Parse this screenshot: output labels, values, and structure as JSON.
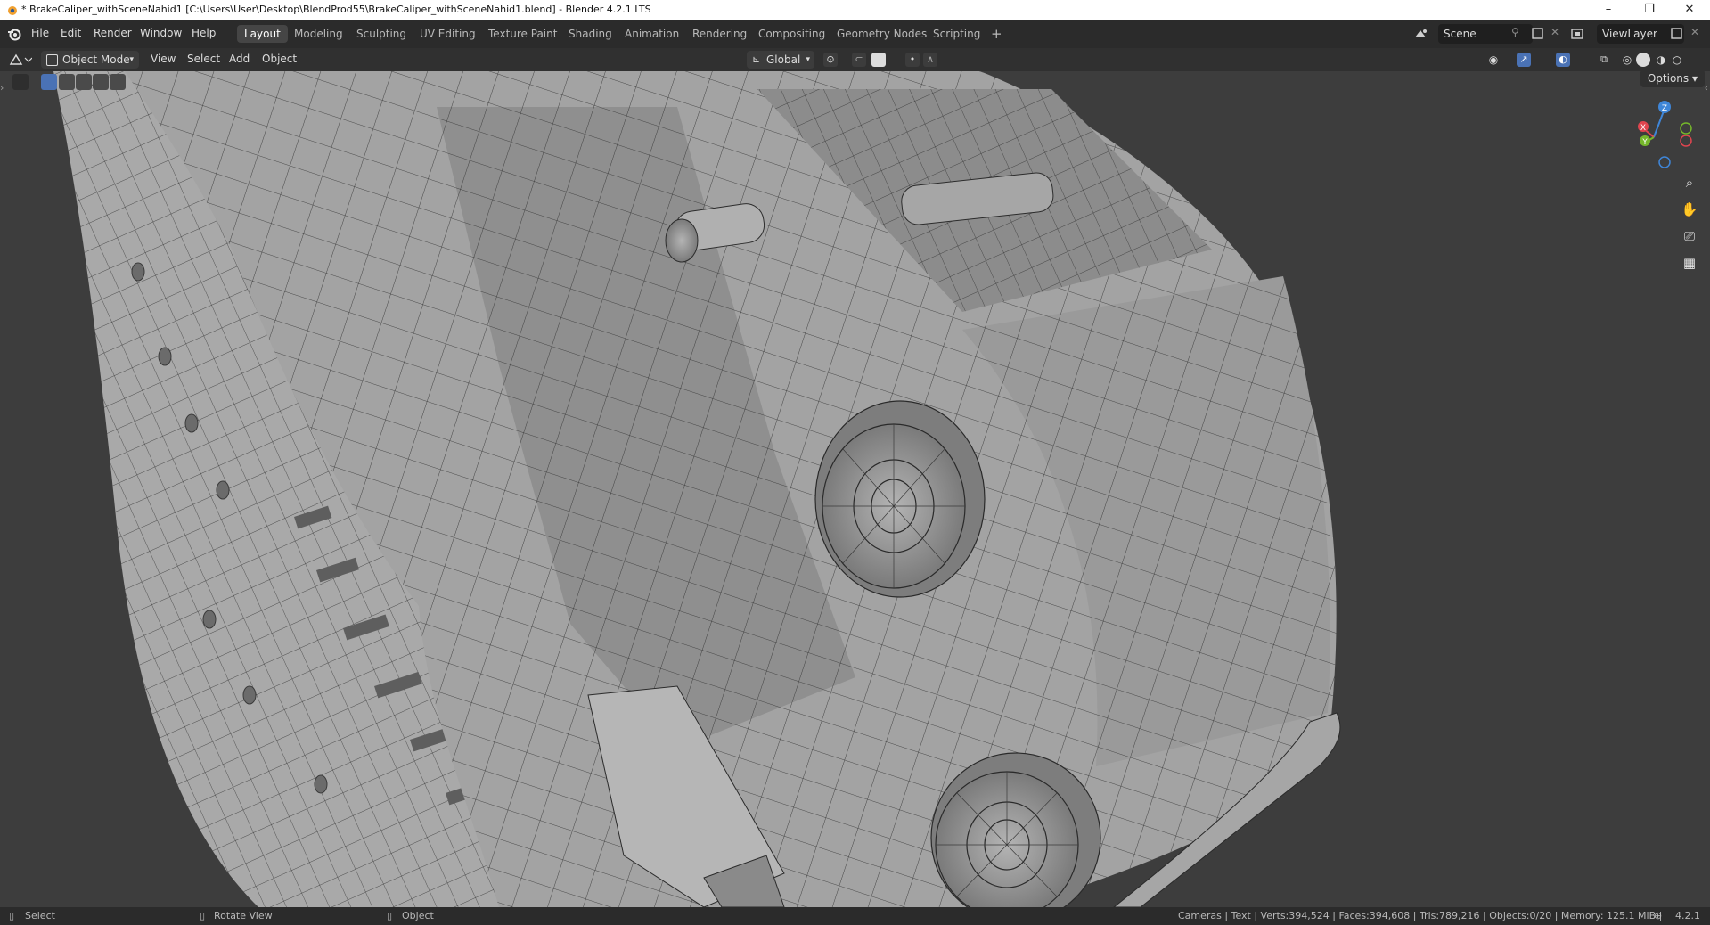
{
  "window": {
    "title": "* BrakeCaliper_withSceneNahid1 [C:\\Users\\User\\Desktop\\BlendProd55\\BrakeCaliper_withSceneNahid1.blend] - Blender 4.2.1 LTS",
    "controls": [
      "–",
      "❐",
      "✕"
    ]
  },
  "menu": [
    "File",
    "Edit",
    "Render",
    "Window",
    "Help"
  ],
  "workspaces": {
    "tabs": [
      "Layout",
      "Modeling",
      "Sculpting",
      "UV Editing",
      "Texture Paint",
      "Shading",
      "Animation",
      "Rendering",
      "Compositing",
      "Geometry Nodes",
      "Scripting"
    ],
    "active": "Layout",
    "add_label": "+"
  },
  "scene": {
    "name": "Scene",
    "view_layer": "ViewLayer"
  },
  "header": {
    "mode": "Object Mode",
    "menus": [
      "View",
      "Select",
      "Add",
      "Object"
    ],
    "orientation": "Global"
  },
  "viewport": {
    "options_label": "Options",
    "gizmo_axes": [
      "X",
      "Y",
      "Z"
    ],
    "shading_active": "solid"
  },
  "statusbar": {
    "left": [
      "Select",
      "Rotate View",
      "Object"
    ],
    "stats": "Cameras | Text | Verts:394,524 | Faces:394,608 | Tris:789,216 | Objects:0/20 | Memory: 125.1 MiB | ",
    "version": "4.2.1"
  },
  "colors": {
    "accent_active_tab": "#454545",
    "active_tool": "#4a72b5",
    "axis_x": "#e0454f",
    "axis_y": "#75b72b",
    "axis_z": "#3f86d8"
  }
}
